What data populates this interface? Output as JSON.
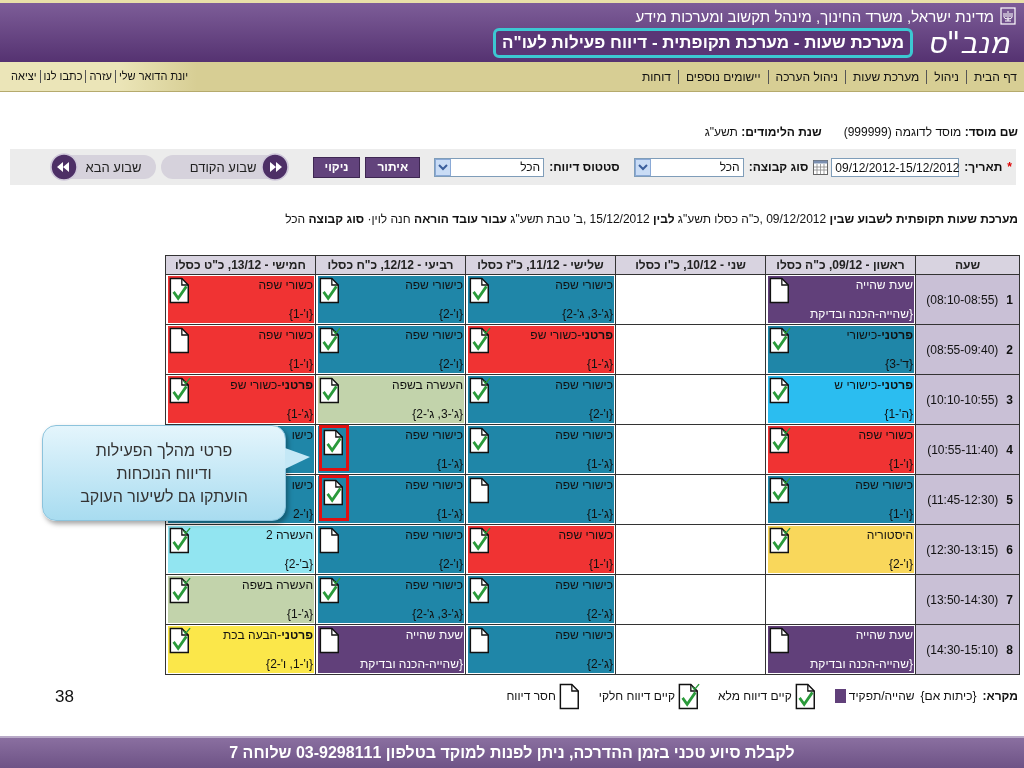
{
  "header": {
    "ministry": "מדינת ישראל, משרד החינוך, מינהל תקשוב ומערכות מידע",
    "logo": "מנב\"ס",
    "title": "מערכת שעות - מערכת תקופתית - דיווח פעילות לעו\"ה"
  },
  "nav": {
    "items": [
      "דף הבית",
      "ניהול",
      "מערכת שעות",
      "ניהול הערכה",
      "יישומים נוספים",
      "דוחות"
    ],
    "user_links": [
      "יונת הדואר שלי",
      "עזרה",
      "כתבו לנו",
      "יציאה"
    ]
  },
  "school": {
    "name_label": "שם מוסד:",
    "name": "מוסד לדוגמה (999999)",
    "year_label": "שנת הלימודים:",
    "year": "תשע\"ג"
  },
  "filters": {
    "required_mark": "*",
    "date_label": "תאריך:",
    "date": "09/12/2012-15/12/2012",
    "group_label": "סוג קבוצה:",
    "group": "הכל",
    "status_label": "סטטוס דיווח:",
    "status": "הכל",
    "buttons": [
      "איתור",
      "ניקוי"
    ],
    "prev_week": "שבוע הקודם",
    "next_week": "שבוע הבא"
  },
  "summary": "**מערכת שעות תקופתית לשבוע שבין** 09/12/2012 ,כ\"ה כסלו תשע\"ג **לבין** 15/12/2012 ,ב' טבת תשע\"ג **עבור עובד הוראה** חנה לוין· **סוג קבוצה** הכל",
  "table": {
    "period_header": "שעה",
    "columns": [
      "ראשון - 09/12, כ\"ה כסלו",
      "שני - 10/12, כ\"ו כסלו",
      "שלישי - 11/12, כ\"ז כסלו",
      "רביעי - 12/12, כ\"ח כסלו",
      "חמישי - 13/12, כ\"ט כסלו"
    ],
    "rows": [
      {
        "number": "1",
        "time": "(08:10-08:55)",
        "cells": [
          {
            "title": "שעת שהייה",
            "group": "{שהייה-הכנה ובדיקת",
            "color": "#61407a",
            "report": {
              "kind": "missing"
            },
            "marked": false
          },
          "",
          {
            "title": "כישורי שפה",
            "group": "{ג'-3, ג'-2}",
            "color": "#1f86a8",
            "report": {
              "kind": "full"
            },
            "marked": false
          },
          {
            "title": "כישורי שפה",
            "group": "{ו'-2}",
            "color": "#1f86a8",
            "report": {
              "kind": "full"
            },
            "marked": false
          },
          {
            "title": "כשורי שפה",
            "group": "{ו'-1}",
            "color": "#f03333",
            "report": {
              "kind": "full"
            },
            "marked": false
          }
        ]
      },
      {
        "number": "2",
        "time": "(08:55-09:40)",
        "cells": [
          {
            "title": "**פרטני**-כישורי",
            "group": "{ד'-3}",
            "color": "#1f86a8",
            "report": {
              "kind": "partial"
            },
            "marked": false
          },
          "",
          {
            "title": "**פרטני**-כשורי שפ",
            "group": "{ג'-1}",
            "color": "#f03333",
            "report": {
              "kind": "partial"
            },
            "marked": false
          },
          {
            "title": "כישורי שפה",
            "group": "{ו'-2}",
            "color": "#1f86a8",
            "report": {
              "kind": "partial"
            },
            "marked": false
          },
          {
            "title": "כשורי שפה",
            "group": "{ו'-1}",
            "color": "#f03333",
            "report": {
              "kind": "missing"
            },
            "marked": false
          }
        ]
      },
      {
        "number": "3",
        "time": "(10:10-10:55)",
        "cells": [
          {
            "title": "**פרטני**-כישורי ש",
            "group": "{ה'-1}",
            "color": "#2bbdf0",
            "report": {
              "kind": "full"
            },
            "marked": false
          },
          "",
          {
            "title": "כישורי שפה",
            "group": "{ו'-2}",
            "color": "#1f86a8",
            "report": {
              "kind": "partial"
            },
            "marked": false
          },
          {
            "title": "העשרה בשפה",
            "group": "{ג'-3, ג'-2}",
            "color": "#c2d3ab",
            "report": {
              "kind": "full"
            },
            "marked": false
          },
          {
            "title": "**פרטני**-כשורי שפ",
            "group": "{ג'-1}",
            "color": "#f03333",
            "report": {
              "kind": "partial"
            },
            "marked": false
          }
        ]
      },
      {
        "number": "4",
        "time": "(10:55-11:40)",
        "cells": [
          {
            "title": "כשורי שפה",
            "group": "{ו'-1}",
            "color": "#f03333",
            "report": {
              "kind": "partial"
            },
            "marked": false
          },
          "",
          {
            "title": "כישורי שפה",
            "group": "{ג'-1}",
            "color": "#1f86a8",
            "report": {
              "kind": "full"
            },
            "marked": false
          },
          {
            "title": "כישורי שפה",
            "group": "{ג'-1}",
            "color": "#1f86a8",
            "report": {
              "kind": "full"
            },
            "marked": true
          },
          {
            "title": "כישו",
            "color": "#1f86a8"
          }
        ]
      },
      {
        "number": "5",
        "time": "(11:45-12:30)",
        "cells": [
          {
            "title": "כישורי שפה",
            "group": "{ו'-1}",
            "color": "#1f86a8",
            "report": {
              "kind": "partial"
            },
            "marked": false
          },
          "",
          {
            "title": "כישורי שפה",
            "group": "{ג'-1}",
            "color": "#1f86a8",
            "report": {
              "kind": "missing"
            },
            "marked": false
          },
          {
            "title": "כישורי שפה",
            "group": "{ג'-1}",
            "color": "#1f86a8",
            "report": {
              "kind": "full"
            },
            "marked": true
          },
          {
            "title": "כישו",
            "group": "{ו'-2",
            "color": "#1f86a8"
          }
        ]
      },
      {
        "number": "6",
        "time": "(12:30-13:15)",
        "cells": [
          {
            "title": "היסטוריה",
            "group": "{ו'-2}",
            "color": "#f9d75b",
            "report": {
              "kind": "partial"
            },
            "marked": false
          },
          "",
          {
            "title": "כשורי שפה",
            "group": "{ו'-1}",
            "color": "#f03333",
            "report": {
              "kind": "partial"
            },
            "marked": false
          },
          {
            "title": "כישורי שפה",
            "group": "{ו'-2}",
            "color": "#1f86a8",
            "report": {
              "kind": "missing"
            },
            "marked": false
          },
          {
            "title": "העשרה 2",
            "group": "{ב'-2}",
            "color": "#92e5f1",
            "report": {
              "kind": "partial"
            },
            "marked": false
          }
        ]
      },
      {
        "number": "7",
        "time": "(13:50-14:30)",
        "cells": [
          "",
          "",
          {
            "title": "כישורי שפה",
            "group": "{ג'-2}",
            "color": "#1f86a8",
            "report": {
              "kind": "full"
            },
            "marked": false
          },
          {
            "title": "כישורי שפה",
            "group": "{ג'-3, ג'-2}",
            "color": "#1f86a8",
            "report": {
              "kind": "partial"
            },
            "marked": false
          },
          {
            "title": "העשרה בשפה",
            "group": "{ג'-1}",
            "color": "#c2d3ab",
            "report": {
              "kind": "partial"
            },
            "marked": false
          }
        ]
      },
      {
        "number": "8",
        "time": "(14:30-15:10)",
        "cells": [
          {
            "title": "שעת שהייה",
            "group": "{שהייה-הכנה ובדיקת",
            "color": "#61407a",
            "report": {
              "kind": "missing"
            },
            "marked": false
          },
          "",
          {
            "title": "כישורי שפה",
            "group": "{ג'-2}",
            "color": "#1f86a8",
            "report": {
              "kind": "missing"
            },
            "marked": false
          },
          {
            "title": "שעת שהייה",
            "group": "{שהייה-הכנה ובדיקת",
            "color": "#61407a",
            "report": {
              "kind": "missing"
            },
            "marked": false
          },
          {
            "title": "**פרטני**-הבעה בכת",
            "group": "{ו'-1, ו'-2}",
            "color": "#fbe74a",
            "report": {
              "kind": "partial"
            },
            "marked": false
          }
        ]
      }
    ]
  },
  "legend": {
    "label": "מקרא:",
    "homeroom": "{כיתות אם}",
    "items": [
      {
        "kind": "swatch",
        "color": "#61407a",
        "label": "שהייה/תפקיד"
      },
      {
        "kind": "full",
        "label": "קיים דיווח מלא"
      },
      {
        "kind": "partial",
        "label": "קיים דיווח חלקי"
      },
      {
        "kind": "missing",
        "label": "חסר דיווח"
      }
    ]
  },
  "callout": {
    "lines": [
      "פרטי מהלך הפעילות",
      "ודיווח הנוכחות",
      "הועתקו גם לשיעור העוקב"
    ]
  },
  "slide_number": "38",
  "footer": "לקבלת סיוע טכני בזמן ההדרכה, ניתן לפנות למוקד בטלפון 03-9298111 שלוחה 7"
}
